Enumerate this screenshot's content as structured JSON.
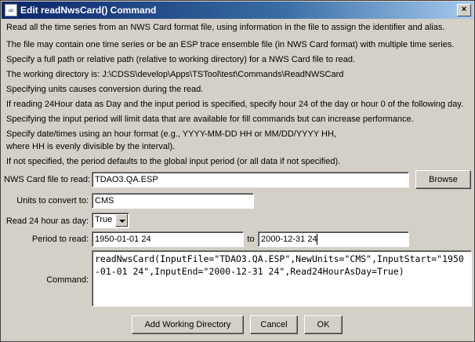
{
  "window": {
    "title": "Edit readNwsCard() Command",
    "close_glyph": "×"
  },
  "info_lines": [
    "Read all the time series from an NWS Card format file, using information in the file to assign the identifier and alias.",
    "The file may contain one time series or be an ESP trace ensemble file (in NWS Card format) with multiple time series.",
    "Specify a full path or relative path (relative to working directory) for a NWS Card file to read.",
    "The working directory is: J:\\CDSS\\develop\\Apps\\TSTool\\test\\Commands\\ReadNWSCard",
    "Specifying units causes conversion during the read.",
    "If reading 24Hour data as Day and the input period is specified, specify hour 24 of the day or hour 0 of the  following day.",
    "Specifying the input period will limit data that are available for fill commands but can increase performance.",
    "Specify date/times using an hour format (e.g., YYYY-MM-DD HH or MM/DD/YYYY HH,",
    "where HH is evenly divisible by the interval).",
    "If not specified, the period defaults to the global input period (or all data if not specified)."
  ],
  "form": {
    "card_file_label": "NWS Card file to read:",
    "card_file_value": "TDAO3.QA.ESP",
    "browse_label": "Browse",
    "units_label": "Units to convert to:",
    "units_value": "CMS",
    "read24_label": "Read 24 hour as day:",
    "read24_value": "True",
    "period_label": "Period to read:",
    "period_start": "1950-01-01 24",
    "period_to": "to",
    "period_end": "2000-12-31 24",
    "command_label": "Command:",
    "command_text": "readNwsCard(InputFile=\"TDAO3.QA.ESP\",NewUnits=\"CMS\",InputStart=\"1950-01-01 24\",InputEnd=\"2000-12-31 24\",Read24HourAsDay=True)"
  },
  "buttons": {
    "add_working_dir": "Add Working Directory",
    "cancel": "Cancel",
    "ok": "OK"
  }
}
